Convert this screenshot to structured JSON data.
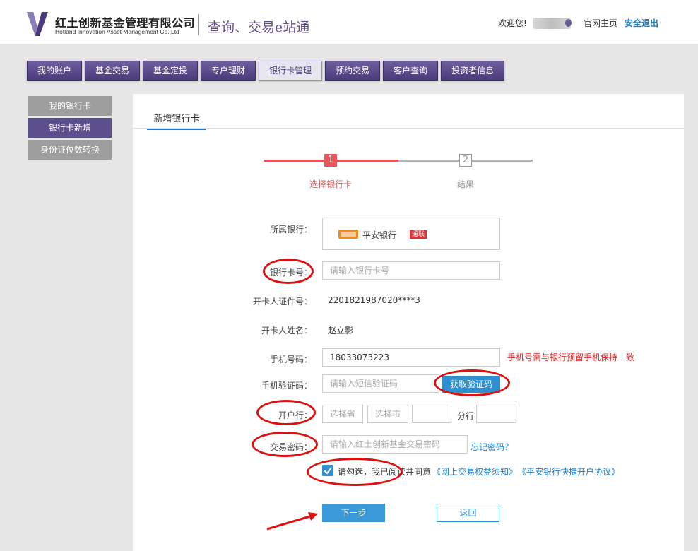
{
  "header": {
    "company_cn": "红土创新基金管理有限公司",
    "company_en": "Hotland Innovation Asset Management Co.,Ltd",
    "slogan": "查询、交易e站通",
    "welcome": "欢迎您!",
    "home_link": "官网主页",
    "logout_link": "安全退出",
    "logo_color": "#4a3b7c"
  },
  "nav": {
    "tabs": [
      "我的账户",
      "基金交易",
      "基金定投",
      "专户理财",
      "银行卡管理",
      "预约交易",
      "客户查询",
      "投资者信息"
    ],
    "active_index": 4
  },
  "sidebar": {
    "items": [
      "我的银行卡",
      "银行卡新增",
      "身份证位数转换"
    ],
    "active_index": 1
  },
  "panel": {
    "tab_label": "新增银行卡"
  },
  "steps": {
    "items": [
      {
        "num": "1",
        "label": "选择银行卡"
      },
      {
        "num": "2",
        "label": "结果"
      }
    ],
    "active_color": "#e8585a",
    "inactive_color": "#b5b5b5"
  },
  "form": {
    "bank_label": "所属银行：",
    "bank_name": "平安银行",
    "bank_badge": "通联",
    "card_label": "银行卡号：",
    "card_placeholder": "请输入银行卡号",
    "id_label": "开卡人证件号：",
    "id_value": "2201821987020****3",
    "name_label": "开卡人姓名：",
    "name_value": "赵立影",
    "phone_label": "手机号码：",
    "phone_value": "18033073223",
    "phone_hint": "手机号需与银行预留手机保持一致",
    "code_label": "手机验证码：",
    "code_placeholder": "请输入短信验证码",
    "code_button": "获取验证码",
    "branch_label": "开户行：",
    "province_placeholder": "选择省",
    "city_placeholder": "选择市",
    "branch_suffix": "分行",
    "password_label": "交易密码：",
    "password_placeholder": "请输入红土创新基金交易密码",
    "forgot_link": "忘记密码？",
    "agree_prefix": "请勾选，我已阅读并同意",
    "agree_link1": "《网上交易权益须知》",
    "agree_link2": "《平安银行快捷开户协议》",
    "next_button": "下一步",
    "back_button": "返回"
  }
}
